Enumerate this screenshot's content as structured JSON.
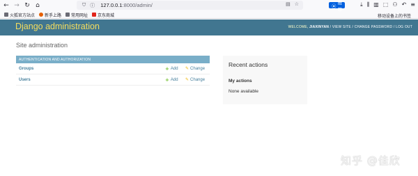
{
  "browser": {
    "url_host": "127.0.0.1",
    "url_rest": ":8000/admin/",
    "translate_label": "推荐",
    "bookmarks": [
      {
        "label": "火狐官方站点",
        "color": "#e66000"
      },
      {
        "label": "新手上路",
        "color": "#e66000"
      },
      {
        "label": "常用网址",
        "color": "#6b6b75"
      },
      {
        "label": "京东商城",
        "color": "#e1251b"
      }
    ],
    "mobile_bookmarks_label": "移动设备上的书签",
    "icons": {
      "back": "back-arrow-icon",
      "forward": "forward-arrow-icon",
      "reload": "reload-icon",
      "home": "home-icon"
    }
  },
  "header": {
    "brand": "Django administration",
    "welcome": "WELCOME, ",
    "username": "JIAXINYAN",
    "view_site": "VIEW SITE",
    "change_password": "CHANGE PASSWORD",
    "log_out": "LOG OUT",
    "sep": " / ",
    "colors": {
      "bar": "#417690",
      "brand": "#f5dd5d"
    }
  },
  "content": {
    "title": "Site administration",
    "module": {
      "caption": "AUTHENTICATION AND AUTHORIZATION",
      "rows": [
        {
          "name": "Groups",
          "add": "Add",
          "change": "Change"
        },
        {
          "name": "Users",
          "add": "Add",
          "change": "Change"
        }
      ]
    },
    "recent": {
      "title": "Recent actions",
      "my_actions": "My actions",
      "empty": "None available"
    }
  },
  "watermark": "知乎 @佳欣"
}
